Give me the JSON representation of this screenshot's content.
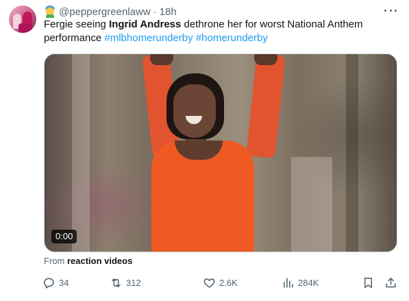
{
  "tweet": {
    "handle": "@peppergreenlaww",
    "separator": "·",
    "time": "18h",
    "text_pre": "Fergie seeing ",
    "text_bold": "Ingrid Andress",
    "text_post": " dethrone her for worst National Anthem performance ",
    "hashtag1": "#mlbhomerunderby",
    "hashtag2": "#homerunderby"
  },
  "media": {
    "duration": "0:00"
  },
  "source": {
    "prefix": "From ",
    "name": "reaction videos"
  },
  "actions": {
    "replies": "34",
    "reposts": "312",
    "likes": "2.6K",
    "views": "284K"
  },
  "colors": {
    "accent": "#1d9bf0",
    "text": "#0f1419",
    "secondary": "#536471"
  },
  "icons": [
    "avatar",
    "emoji-badge-icon",
    "more-icon",
    "reply-icon",
    "retweet-icon",
    "like-icon",
    "views-icon",
    "bookmark-icon",
    "share-icon"
  ]
}
